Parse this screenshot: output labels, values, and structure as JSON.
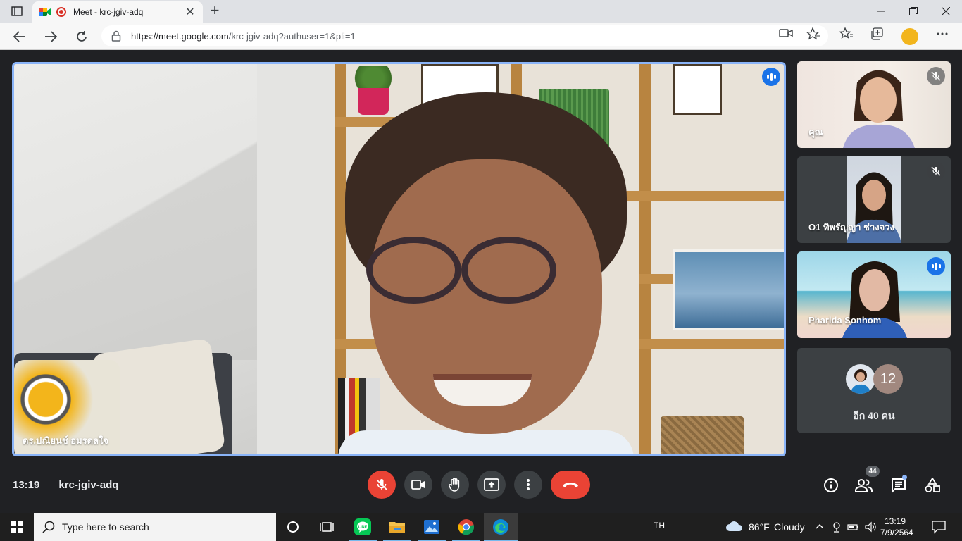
{
  "browser": {
    "tab_title": "Meet - krc-jgiv-adq",
    "new_tab_label": "+",
    "url_host": "https://meet.google.com",
    "url_path": "/krc-jgiv-adq?authuser=1&pli=1"
  },
  "main_speaker": {
    "name": "ดร.ปณิยนช์ อมรดลใจ"
  },
  "participants": [
    {
      "name": "คุณ",
      "status": "muted"
    },
    {
      "name": "O1 ทิพรัญญา ช่างจวง",
      "status": "muted"
    },
    {
      "name": "Pharida Sonhom",
      "status": "speaking"
    }
  ],
  "others": {
    "badge_count": "12",
    "label": "อีก 40 คน"
  },
  "meeting": {
    "time": "13:19",
    "code": "krc-jgiv-adq",
    "people_count": "44"
  },
  "controls": [
    "mic-off",
    "camera",
    "raise-hand",
    "present",
    "more-options",
    "leave-call"
  ],
  "right_controls": [
    "meeting-details",
    "people",
    "chat",
    "activities"
  ],
  "taskbar": {
    "search_placeholder": "Type here to search",
    "language": "TH",
    "weather_temp": "86°F",
    "weather_desc": "Cloudy",
    "clock_time": "13:19",
    "clock_date": "7/9/2564"
  },
  "colors": {
    "meet_bg": "#202124",
    "speaking_border": "#8ab4f8",
    "end_call": "#ea4335",
    "speak_indicator": "#1a73e8"
  }
}
